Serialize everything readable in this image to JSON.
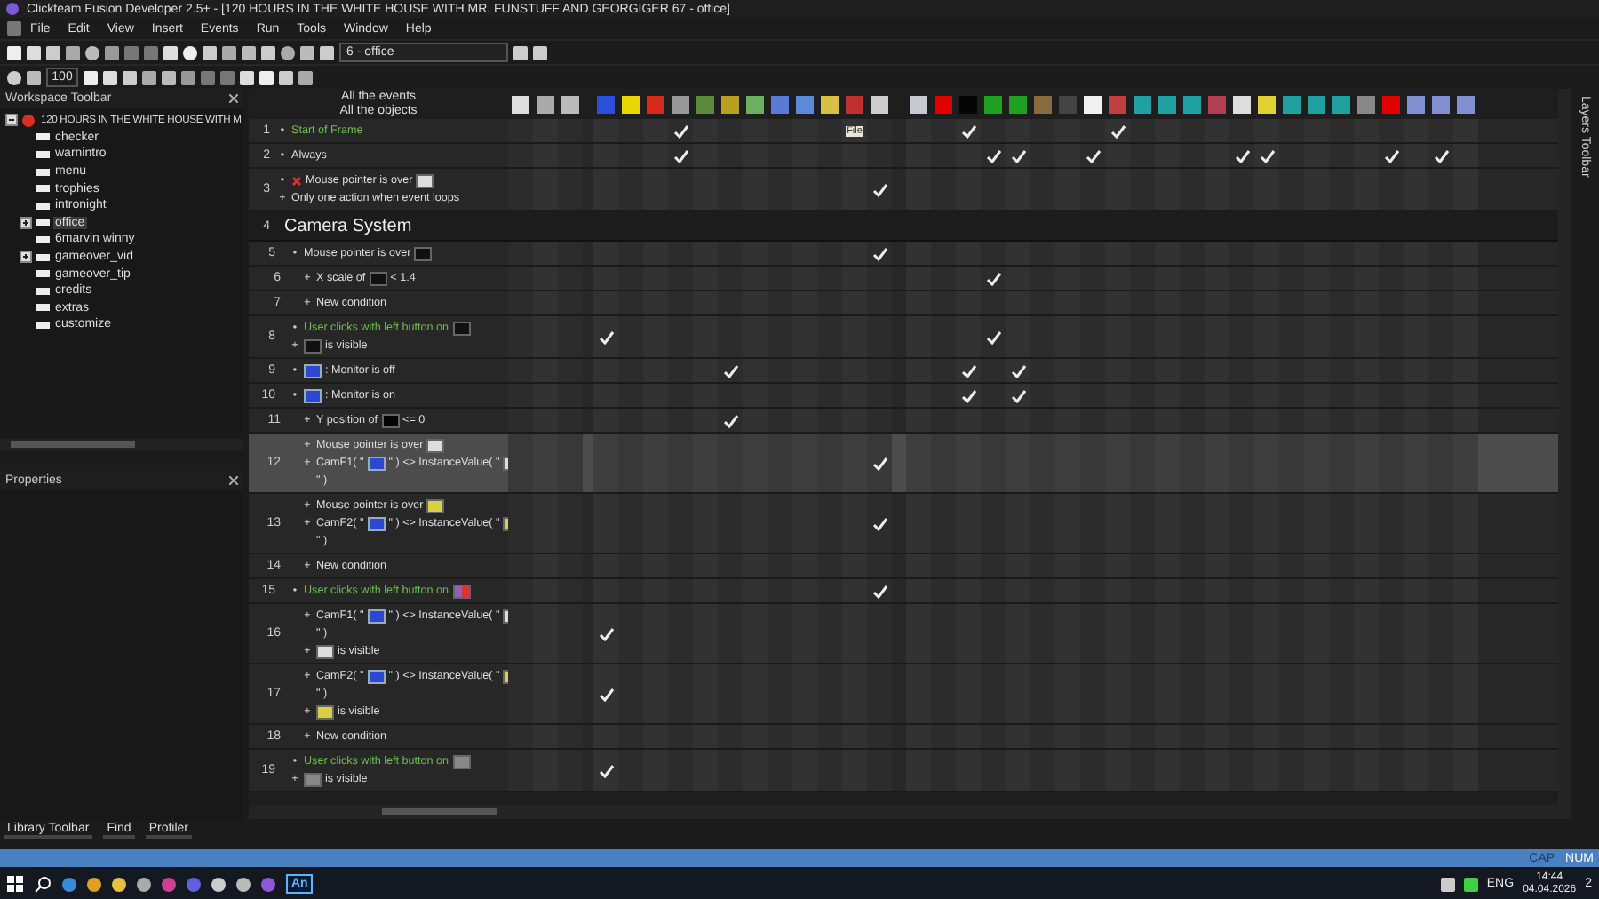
{
  "window": {
    "title": "Clickteam Fusion Developer 2.5+ - [120 HOURS IN THE WHITE HOUSE WITH MR. FUNSTUFF AND GEORGIGER 67 - office]"
  },
  "menu": [
    "File",
    "Edit",
    "View",
    "Insert",
    "Events",
    "Run",
    "Tools",
    "Window",
    "Help"
  ],
  "toolbar": {
    "frame_dropdown": "6 - office",
    "zoom_field": "100"
  },
  "workspace": {
    "title": "Workspace Toolbar",
    "tree": [
      {
        "label": "120 HOURS IN THE WHITE HOUSE WITH M",
        "selected": false,
        "expanded": true,
        "children": [
          {
            "label": "checker",
            "selected": false
          },
          {
            "label": "warnintro",
            "selected": false
          },
          {
            "label": "menu",
            "selected": false
          },
          {
            "label": "trophies",
            "selected": false
          },
          {
            "label": "intronight",
            "selected": false
          },
          {
            "label": "office",
            "selected": true,
            "expanded": false
          },
          {
            "label": "6marvin winny",
            "selected": false
          },
          {
            "label": "gameover_vid",
            "selected": false,
            "expanded": false
          },
          {
            "label": "gameover_tip",
            "selected": false
          },
          {
            "label": "credits",
            "selected": false
          },
          {
            "label": "extras",
            "selected": false
          },
          {
            "label": "customize",
            "selected": false
          }
        ]
      }
    ]
  },
  "properties": {
    "title": "Properties"
  },
  "bottom_tabs": [
    "Library Toolbar",
    "Find",
    "Profiler"
  ],
  "event_editor": {
    "header": [
      "All the events",
      "All the objects"
    ],
    "events": [
      {
        "kind": "event",
        "number": "1",
        "selected": false,
        "tag": "File",
        "lines": [
          {
            "bullet": "•",
            "triggered": true,
            "parts": [
              {
                "kind": "text",
                "text": "Start of Frame"
              }
            ]
          }
        ],
        "actions": [
          false,
          false,
          false,
          false,
          false,
          false,
          true,
          false,
          false,
          false,
          false,
          false,
          false,
          false,
          false,
          false,
          false,
          true,
          false,
          false,
          false,
          false,
          false,
          true,
          false,
          false,
          false,
          false,
          false,
          false,
          false,
          false,
          false,
          false,
          false,
          false,
          false,
          false
        ]
      },
      {
        "kind": "event",
        "number": "2",
        "selected": false,
        "lines": [
          {
            "bullet": "•",
            "triggered": false,
            "parts": [
              {
                "kind": "text",
                "text": "Always"
              }
            ]
          }
        ],
        "actions": [
          false,
          false,
          false,
          false,
          false,
          false,
          true,
          false,
          false,
          false,
          false,
          false,
          false,
          false,
          false,
          false,
          false,
          false,
          true,
          true,
          false,
          false,
          true,
          false,
          false,
          false,
          false,
          false,
          true,
          true,
          false,
          false,
          false,
          false,
          true,
          false,
          true,
          false
        ]
      },
      {
        "kind": "event",
        "number": "3",
        "selected": false,
        "lines": [
          {
            "bullet": "•",
            "triggered": false,
            "parts": [
              {
                "kind": "cross"
              },
              {
                "kind": "text",
                "text": "Mouse pointer is over"
              },
              {
                "kind": "note"
              }
            ]
          },
          {
            "bullet": "+",
            "triggered": false,
            "parts": [
              {
                "kind": "text",
                "text": "Only one action when event loops"
              }
            ]
          }
        ],
        "actions": [
          false,
          false,
          false,
          false,
          false,
          false,
          false,
          false,
          false,
          false,
          false,
          false,
          false,
          false,
          true,
          false,
          false,
          false,
          false,
          false,
          false,
          false,
          false,
          false,
          false,
          false,
          false,
          false,
          false,
          false,
          false,
          false,
          false,
          false,
          false,
          false,
          false,
          false
        ]
      },
      {
        "kind": "group",
        "number": "4",
        "title": "Camera System",
        "children": [
          {
            "kind": "event",
            "number": "5",
            "selected": false,
            "lines": [
              {
                "bullet": "•",
                "triggered": false,
                "parts": [
                  {
                    "kind": "text",
                    "text": "Mouse pointer is over"
                  },
                  {
                    "kind": "bar"
                  }
                ]
              }
            ],
            "actions": [
              false,
              false,
              false,
              false,
              false,
              false,
              false,
              false,
              false,
              false,
              false,
              false,
              false,
              false,
              true,
              false,
              false,
              false,
              false,
              false,
              false,
              false,
              false,
              false,
              false,
              false,
              false,
              false,
              false,
              false,
              false,
              false,
              false,
              false,
              false,
              false,
              false,
              false
            ],
            "children": [
              {
                "kind": "event",
                "number": "6",
                "selected": false,
                "lines": [
                  {
                    "bullet": "+",
                    "triggered": false,
                    "parts": [
                      {
                        "kind": "text",
                        "text": "X scale of"
                      },
                      {
                        "kind": "bar"
                      },
                      {
                        "kind": "text",
                        "text": "< 1.4"
                      }
                    ]
                  }
                ],
                "actions": [
                  false,
                  false,
                  false,
                  false,
                  false,
                  false,
                  false,
                  false,
                  false,
                  false,
                  false,
                  false,
                  false,
                  false,
                  false,
                  false,
                  false,
                  false,
                  true,
                  false,
                  false,
                  false,
                  false,
                  false,
                  false,
                  false,
                  false,
                  false,
                  false,
                  false,
                  false,
                  false,
                  false,
                  false,
                  false,
                  false,
                  false,
                  false
                ]
              },
              {
                "kind": "event",
                "number": "7",
                "selected": false,
                "lines": [
                  {
                    "bullet": "+",
                    "triggered": false,
                    "parts": [
                      {
                        "kind": "text",
                        "text": "New condition"
                      }
                    ]
                  }
                ],
                "actions": [
                  false,
                  false,
                  false,
                  false,
                  false,
                  false,
                  false,
                  false,
                  false,
                  false,
                  false,
                  false,
                  false,
                  false,
                  false,
                  false,
                  false,
                  false,
                  false,
                  false,
                  false,
                  false,
                  false,
                  false,
                  false,
                  false,
                  false,
                  false,
                  false,
                  false,
                  false,
                  false,
                  false,
                  false,
                  false,
                  false,
                  false,
                  false
                ]
              }
            ]
          },
          {
            "kind": "event",
            "number": "8",
            "selected": false,
            "lines": [
              {
                "bullet": "•",
                "triggered": true,
                "parts": [
                  {
                    "kind": "text",
                    "text": "User clicks with left button on"
                  },
                  {
                    "kind": "bar"
                  }
                ]
              },
              {
                "bullet": "+",
                "triggered": false,
                "parts": [
                  {
                    "kind": "bar"
                  },
                  {
                    "kind": "text",
                    "text": "is visible"
                  }
                ]
              }
            ],
            "actions": [
              false,
              false,
              false,
              true,
              false,
              false,
              false,
              false,
              false,
              false,
              false,
              false,
              false,
              false,
              false,
              false,
              false,
              false,
              true,
              false,
              false,
              false,
              false,
              false,
              false,
              false,
              false,
              false,
              false,
              false,
              false,
              false,
              false,
              false,
              false,
              false,
              false,
              false
            ]
          },
          {
            "kind": "event",
            "number": "9",
            "selected": false,
            "lines": [
              {
                "bullet": "•",
                "triggered": false,
                "parts": [
                  {
                    "kind": "monitor"
                  },
                  {
                    "kind": "text",
                    "text": ": Monitor is off"
                  }
                ]
              }
            ],
            "actions": [
              false,
              false,
              false,
              false,
              false,
              false,
              false,
              false,
              true,
              false,
              false,
              false,
              false,
              false,
              false,
              false,
              false,
              true,
              false,
              true,
              false,
              false,
              false,
              false,
              false,
              false,
              false,
              false,
              false,
              false,
              false,
              false,
              false,
              false,
              false,
              false,
              false,
              false
            ]
          },
          {
            "kind": "event",
            "number": "10",
            "selected": false,
            "lines": [
              {
                "bullet": "•",
                "triggered": false,
                "parts": [
                  {
                    "kind": "monitor"
                  },
                  {
                    "kind": "text",
                    "text": ": Monitor is on"
                  }
                ]
              }
            ],
            "actions": [
              false,
              false,
              false,
              false,
              false,
              false,
              false,
              false,
              false,
              false,
              false,
              false,
              false,
              false,
              false,
              false,
              false,
              true,
              false,
              true,
              false,
              false,
              false,
              false,
              false,
              false,
              false,
              false,
              false,
              false,
              false,
              false,
              false,
              false,
              false,
              false,
              false,
              false
            ],
            "children": [
              {
                "kind": "event",
                "number": "11",
                "selected": false,
                "lines": [
                  {
                    "bullet": "+",
                    "triggered": false,
                    "parts": [
                      {
                        "kind": "text",
                        "text": "Y position of"
                      },
                      {
                        "kind": "dark"
                      },
                      {
                        "kind": "text",
                        "text": "<= 0"
                      }
                    ]
                  }
                ],
                "actions": [
                  false,
                  false,
                  false,
                  false,
                  false,
                  false,
                  false,
                  false,
                  true,
                  false,
                  false,
                  false,
                  false,
                  false,
                  false,
                  false,
                  false,
                  false,
                  false,
                  false,
                  false,
                  false,
                  false,
                  false,
                  false,
                  false,
                  false,
                  false,
                  false,
                  false,
                  false,
                  false,
                  false,
                  false,
                  false,
                  false,
                  false,
                  false
                ]
              },
              {
                "kind": "event",
                "number": "12",
                "selected": true,
                "lines": [
                  {
                    "bullet": "+",
                    "triggered": false,
                    "parts": [
                      {
                        "kind": "text",
                        "text": "Mouse pointer is over"
                      },
                      {
                        "kind": "note"
                      }
                    ]
                  },
                  {
                    "bullet": "+",
                    "triggered": false,
                    "parts": [
                      {
                        "kind": "text",
                        "text": "CamF1( \""
                      },
                      {
                        "kind": "monitor"
                      },
                      {
                        "kind": "text",
                        "text": "\" ) <> InstanceValue( \""
                      },
                      {
                        "kind": "note"
                      }
                    ]
                  },
                  {
                    "triggered": false,
                    "parts": [
                      {
                        "kind": "text",
                        "text": "\" )"
                      }
                    ]
                  }
                ],
                "actions": [
                  false,
                  false,
                  false,
                  false,
                  false,
                  false,
                  false,
                  false,
                  false,
                  false,
                  false,
                  false,
                  false,
                  false,
                  true,
                  false,
                  false,
                  false,
                  false,
                  false,
                  false,
                  false,
                  false,
                  false,
                  false,
                  false,
                  false,
                  false,
                  false,
                  false,
                  false,
                  false,
                  false,
                  false,
                  false,
                  false,
                  false,
                  false
                ]
              },
              {
                "kind": "event",
                "number": "13",
                "selected": false,
                "lines": [
                  {
                    "bullet": "+",
                    "triggered": false,
                    "parts": [
                      {
                        "kind": "text",
                        "text": "Mouse pointer is over"
                      },
                      {
                        "kind": "badge"
                      }
                    ]
                  },
                  {
                    "bullet": "+",
                    "triggered": false,
                    "parts": [
                      {
                        "kind": "text",
                        "text": "CamF2( \""
                      },
                      {
                        "kind": "monitor"
                      },
                      {
                        "kind": "text",
                        "text": "\" ) <> InstanceValue( \""
                      },
                      {
                        "kind": "badge"
                      }
                    ]
                  },
                  {
                    "triggered": false,
                    "parts": [
                      {
                        "kind": "text",
                        "text": "\" )"
                      }
                    ]
                  }
                ],
                "actions": [
                  false,
                  false,
                  false,
                  false,
                  false,
                  false,
                  false,
                  false,
                  false,
                  false,
                  false,
                  false,
                  false,
                  false,
                  true,
                  false,
                  false,
                  false,
                  false,
                  false,
                  false,
                  false,
                  false,
                  false,
                  false,
                  false,
                  false,
                  false,
                  false,
                  false,
                  false,
                  false,
                  false,
                  false,
                  false,
                  false,
                  false,
                  false
                ]
              },
              {
                "kind": "event",
                "number": "14",
                "selected": false,
                "lines": [
                  {
                    "bullet": "+",
                    "triggered": false,
                    "parts": [
                      {
                        "kind": "text",
                        "text": "New condition"
                      }
                    ]
                  }
                ],
                "actions": [
                  false,
                  false,
                  false,
                  false,
                  false,
                  false,
                  false,
                  false,
                  false,
                  false,
                  false,
                  false,
                  false,
                  false,
                  false,
                  false,
                  false,
                  false,
                  false,
                  false,
                  false,
                  false,
                  false,
                  false,
                  false,
                  false,
                  false,
                  false,
                  false,
                  false,
                  false,
                  false,
                  false,
                  false,
                  false,
                  false,
                  false,
                  false
                ]
              }
            ]
          },
          {
            "kind": "event",
            "number": "15",
            "selected": false,
            "lines": [
              {
                "bullet": "•",
                "triggered": true,
                "parts": [
                  {
                    "kind": "text",
                    "text": "User clicks with left button on"
                  },
                  {
                    "kind": "button"
                  }
                ]
              }
            ],
            "actions": [
              false,
              false,
              false,
              false,
              false,
              false,
              false,
              false,
              false,
              false,
              false,
              false,
              false,
              false,
              true,
              false,
              false,
              false,
              false,
              false,
              false,
              false,
              false,
              false,
              false,
              false,
              false,
              false,
              false,
              false,
              false,
              false,
              false,
              false,
              false,
              false,
              false,
              false
            ],
            "children": [
              {
                "kind": "event",
                "number": "16",
                "selected": false,
                "lines": [
                  {
                    "bullet": "+",
                    "triggered": false,
                    "parts": [
                      {
                        "kind": "text",
                        "text": "CamF1( \""
                      },
                      {
                        "kind": "monitor"
                      },
                      {
                        "kind": "text",
                        "text": "\" ) <> InstanceValue( \""
                      },
                      {
                        "kind": "note"
                      }
                    ]
                  },
                  {
                    "triggered": false,
                    "parts": [
                      {
                        "kind": "text",
                        "text": "\" )"
                      }
                    ]
                  },
                  {
                    "bullet": "+",
                    "triggered": false,
                    "parts": [
                      {
                        "kind": "note"
                      },
                      {
                        "kind": "text",
                        "text": "is visible"
                      }
                    ]
                  }
                ],
                "actions": [
                  false,
                  false,
                  false,
                  true,
                  false,
                  false,
                  false,
                  false,
                  false,
                  false,
                  false,
                  false,
                  false,
                  false,
                  false,
                  false,
                  false,
                  false,
                  false,
                  false,
                  false,
                  false,
                  false,
                  false,
                  false,
                  false,
                  false,
                  false,
                  false,
                  false,
                  false,
                  false,
                  false,
                  false,
                  false,
                  false,
                  false,
                  false
                ]
              },
              {
                "kind": "event",
                "number": "17",
                "selected": false,
                "lines": [
                  {
                    "bullet": "+",
                    "triggered": false,
                    "parts": [
                      {
                        "kind": "text",
                        "text": "CamF2( \""
                      },
                      {
                        "kind": "monitor"
                      },
                      {
                        "kind": "text",
                        "text": "\" ) <> InstanceValue( \""
                      },
                      {
                        "kind": "badge"
                      }
                    ]
                  },
                  {
                    "triggered": false,
                    "parts": [
                      {
                        "kind": "text",
                        "text": "\" )"
                      }
                    ]
                  },
                  {
                    "bullet": "+",
                    "triggered": false,
                    "parts": [
                      {
                        "kind": "badge"
                      },
                      {
                        "kind": "text",
                        "text": "is visible"
                      }
                    ]
                  }
                ],
                "actions": [
                  false,
                  false,
                  false,
                  true,
                  false,
                  false,
                  false,
                  false,
                  false,
                  false,
                  false,
                  false,
                  false,
                  false,
                  false,
                  false,
                  false,
                  false,
                  false,
                  false,
                  false,
                  false,
                  false,
                  false,
                  false,
                  false,
                  false,
                  false,
                  false,
                  false,
                  false,
                  false,
                  false,
                  false,
                  false,
                  false,
                  false,
                  false
                ]
              },
              {
                "kind": "event",
                "number": "18",
                "selected": false,
                "lines": [
                  {
                    "bullet": "+",
                    "triggered": false,
                    "parts": [
                      {
                        "kind": "text",
                        "text": "New condition"
                      }
                    ]
                  }
                ],
                "actions": [
                  false,
                  false,
                  false,
                  false,
                  false,
                  false,
                  false,
                  false,
                  false,
                  false,
                  false,
                  false,
                  false,
                  false,
                  false,
                  false,
                  false,
                  false,
                  false,
                  false,
                  false,
                  false,
                  false,
                  false,
                  false,
                  false,
                  false,
                  false,
                  false,
                  false,
                  false,
                  false,
                  false,
                  false,
                  false,
                  false,
                  false,
                  false
                ]
              }
            ]
          },
          {
            "kind": "event",
            "number": "19",
            "selected": false,
            "lines": [
              {
                "bullet": "•",
                "triggered": true,
                "parts": [
                  {
                    "kind": "text",
                    "text": "User clicks with left button on"
                  },
                  {
                    "kind": "panel"
                  }
                ]
              },
              {
                "bullet": "+",
                "triggered": false,
                "parts": [
                  {
                    "kind": "panel"
                  },
                  {
                    "kind": "text",
                    "text": "is visible"
                  }
                ]
              }
            ],
            "actions": [
              false,
              false,
              false,
              true,
              false,
              false,
              false,
              false,
              false,
              false,
              false,
              false,
              false,
              false,
              false,
              false,
              false,
              false,
              false,
              false,
              false,
              false,
              false,
              false,
              false,
              false,
              false,
              false,
              false,
              false,
              false,
              false,
              false,
              false,
              false,
              false,
              false,
              false
            ]
          }
        ]
      }
    ]
  },
  "layers_toolbar": {
    "title": "Layers Toolbar"
  },
  "status_bar": [
    {
      "text": "CAP",
      "on": false
    },
    {
      "text": "NUM",
      "on": true
    }
  ],
  "taskbar": {
    "app_label": "An",
    "language": "ENG",
    "time": "14:44",
    "date": "04.04.2026",
    "notifications": "2"
  }
}
